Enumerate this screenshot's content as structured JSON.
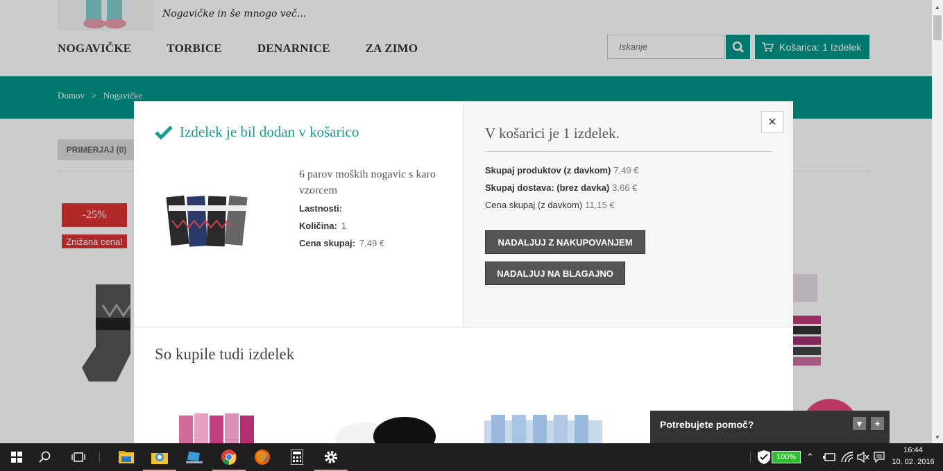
{
  "site": {
    "tagline": "Nogavičke in še mnogo več...",
    "nav": [
      "NOGAVIČKE",
      "TORBICE",
      "DENARNICE",
      "ZA ZIMO"
    ],
    "search_placeholder": "Iskanje",
    "cart_label": "Košarica: 1 Izdelek",
    "breadcrumb_home": "Domov",
    "breadcrumb_sep": ">",
    "breadcrumb_current": "Nogavičke",
    "compare_label": "PRIMERJAJ (0)",
    "discount": "-25%",
    "sale_label": "Znižana cena!"
  },
  "modal": {
    "success_title": "Izdelek je bil dodan v košarico",
    "product_name": "6 parov moških nogavic s karo vzorcem",
    "props_label": "Lastnosti:",
    "qty_label": "Količina:",
    "qty_value": "1",
    "total_label": "Cena skupaj:",
    "total_value": "7,49 €",
    "right_title": "V košarici je 1 izdelek.",
    "products_label": "Skupaj produktov (z davkom)",
    "products_value": "7,49 €",
    "shipping_label": "Skupaj dostava: (brez davka)",
    "shipping_value": "3,66 €",
    "grand_label": "Cena skupaj (z davkom)",
    "grand_value": "11,15 €",
    "continue_btn": "NADALJUJ Z NAKUPOVANJEM",
    "checkout_btn": "NADALJUJ NA BLAGAJNO",
    "close": "×",
    "also_title": "So kupile tudi izdelek"
  },
  "help": {
    "title": "Potrebujete pomoč?",
    "minimize": "▾",
    "expand": "+"
  },
  "taskbar": {
    "battery": "100%",
    "time": "16:44",
    "date": "10. 02. 2016"
  },
  "colors": {
    "brand_teal": "#00968a",
    "sale_red": "#d33333",
    "dark_button": "#555555"
  }
}
